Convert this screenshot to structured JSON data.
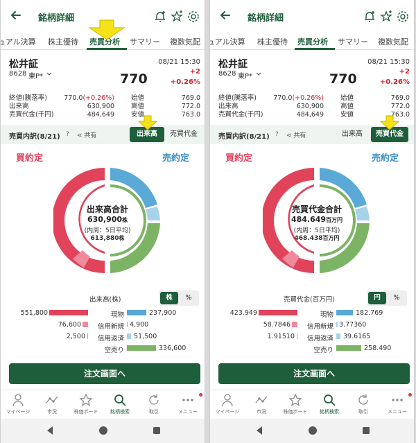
{
  "app": {
    "title": "銘柄詳細"
  },
  "tabs": [
    "ュアル決算",
    "株主優待",
    "売買分析",
    "サマリー",
    "複数気配"
  ],
  "stock": {
    "name": "松井証",
    "code": "8628",
    "market": "東P*",
    "time": "08/21 15:30",
    "price": "770",
    "change": "+2",
    "change_pct": "+0.26%"
  },
  "quote": {
    "rows": [
      {
        "label": "終値(騰落率)",
        "value": "770.0",
        "pct": "(+0.26%)",
        "label2": "始値",
        "value2": "769.0"
      },
      {
        "label": "出来高",
        "value": "630,900",
        "pct": "",
        "label2": "高値",
        "value2": "772.0"
      },
      {
        "label": "売買代金(千円)",
        "value": "484,649",
        "pct": "",
        "label2": "安値",
        "value2": "763.0"
      }
    ]
  },
  "breakdown_bar": {
    "title": "売買内訳(8/21)",
    "help": "?",
    "share": "共有",
    "btn_volume": "出来高",
    "btn_value": "売買代金"
  },
  "labels": {
    "buy": "買約定",
    "sell": "売約定"
  },
  "categories": [
    "現物",
    "信用新規",
    "信用返済",
    "空売り"
  ],
  "left": {
    "center_title": "出来高合計",
    "center_value": "630,900",
    "center_unit": "株",
    "center_sub": "(内周：5日平均)",
    "center_avg": "613,880",
    "center_avg_unit": "株",
    "unit_label": "出来高(株)",
    "unit_btn_a": "株",
    "unit_btn_b": "%",
    "buy_values": [
      "551,800",
      "76,600",
      "2,500",
      ""
    ],
    "sell_values": [
      "237,900",
      "4,900",
      "51,500",
      "336,600"
    ]
  },
  "right": {
    "center_title": "売買代金合計",
    "center_value": "484.649",
    "center_unit": "百万円",
    "center_sub": "(内周：5日平均)",
    "center_avg": "468.438",
    "center_avg_unit": "百万円",
    "unit_label": "売買代金(百万円)",
    "unit_btn_a": "円",
    "unit_btn_b": "%",
    "buy_values": [
      "423.949",
      "58.7846",
      "1.91510",
      ""
    ],
    "sell_values": [
      "182.769",
      "3.77360",
      "39.6165",
      "258.490"
    ]
  },
  "order_button": "注文画面へ",
  "nav": [
    "マイページ",
    "市況",
    "株価ボード",
    "銘柄検索",
    "取引",
    "メニュー"
  ],
  "colors": {
    "brand_green": "#1e5e3a",
    "buy_red": "#e0435a",
    "buy_light": "#f08a9a",
    "sell_blue": "#5aa9d6",
    "sell_light": "#a7d3ea",
    "short_green": "#7db365",
    "up_red": "#d0212d",
    "highlight_yellow": "#f5e21b"
  }
}
